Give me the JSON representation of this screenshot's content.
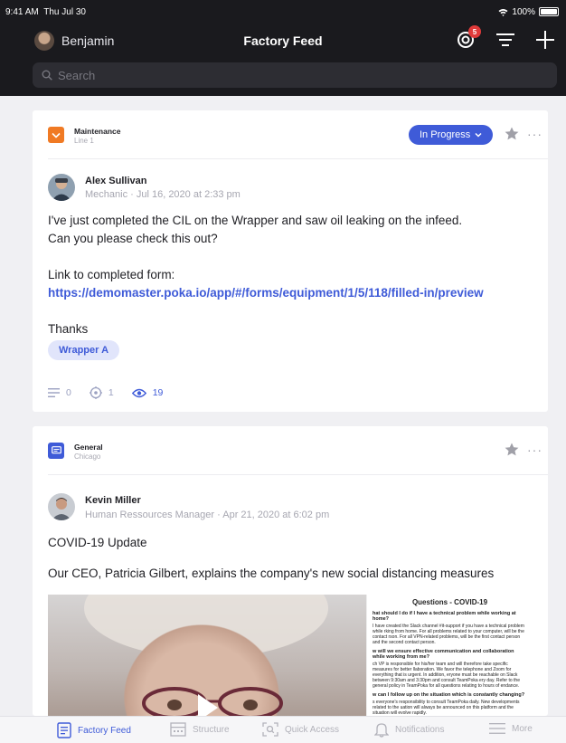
{
  "status_bar": {
    "time": "9:41 AM",
    "date": "Thu Jul 30",
    "battery": "100%"
  },
  "header": {
    "user_name": "Benjamin",
    "title": "Factory Feed",
    "notifications_badge": "5"
  },
  "search": {
    "placeholder": "Search"
  },
  "posts": [
    {
      "channel": {
        "name": "Maintenance",
        "location": "Line 1",
        "icon": "chevron-down-icon",
        "color": "#f07a24"
      },
      "status": "In Progress",
      "author": {
        "name": "Alex Sullivan",
        "meta": "Mechanic · Jul 16, 2020 at 2:33 pm"
      },
      "body": {
        "line1": "I've just completed the CIL on the Wrapper and saw oil leaking on the infeed.",
        "line2": "Can you please check this out?",
        "link_prefix": "Link to completed form: ",
        "link": "https://demomaster.poka.io/app/#/forms/equipment/1/5/118/filled-in/preview",
        "closing": "Thanks"
      },
      "tag": "Wrapper A",
      "stats": {
        "comments": "0",
        "follows": "1",
        "views": "19"
      }
    },
    {
      "channel": {
        "name": "General",
        "location": "Chicago",
        "icon": "chat-icon",
        "color": "#3f5bd8"
      },
      "author": {
        "name": "Kevin Miller",
        "meta": "Human Ressources Manager · Apr 21, 2020 at 6:02 pm"
      },
      "body": {
        "title": "COVID-19 Update",
        "text": "Our CEO, Patricia Gilbert, explains the company's new social distancing measures"
      },
      "doc_preview": {
        "title": "Questions - COVID-19",
        "q1": "hat should I do if I have a technical problem while working at home?",
        "a1": "I have created the Slack channel #it-support if you have a technical problem while rking from home. For all problems related to your computer, will be the contact rson. For all VPN-related problems, will be the first contact person and the second contact person.",
        "q2": "w will we ensure effective communication and collaboration while working from me?",
        "a2": "ch VP is responsible for his/her team and will therefore take specific measures for better llaboration. We favor the telephone and Zoom for everything that is urgent. In addition, eryone must be reachable on Slack between 9:30am and 3:30pm and consult TeamPoka ery day. Refer to the general policy in TeamPoka for all questions relating to hours of endance.",
        "q3": "w can I follow up on the situation which is constantly changing?",
        "a3": "s everyone's responsibility to consult TeamPoka daily. New developments related to the uation will always be announced on this platform and the situation will evolve rapidly."
      }
    }
  ],
  "tabbar": {
    "items": [
      {
        "label": "Factory Feed"
      },
      {
        "label": "Structure"
      },
      {
        "label": "Quick Access"
      },
      {
        "label": "Notifications"
      },
      {
        "label": "More"
      }
    ]
  },
  "colors": {
    "accent": "#3f5bd8",
    "header_bg": "#1a1a1e",
    "maintenance": "#f07a24"
  }
}
